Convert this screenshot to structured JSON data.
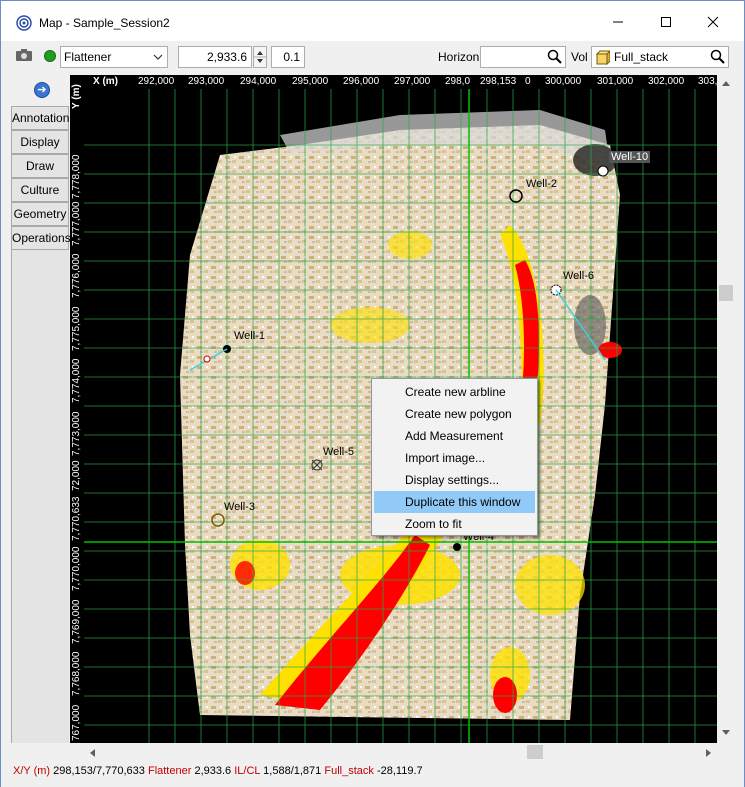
{
  "window": {
    "title": "Map - Sample_Session2",
    "minimize": "—",
    "maximize": "☐",
    "close": "✕"
  },
  "toolbar": {
    "mode_value": "Flattener",
    "value_field": "2,933.6",
    "step_field": "0.1",
    "horizon_label": "Horizon",
    "horizon_value": "",
    "vol_label": "Vol",
    "vol_value": "Full_stack",
    "status_color": "#1e9e1e"
  },
  "sidetabs": [
    "Annotation",
    "Display",
    "Draw",
    "Culture",
    "Geometry",
    "Operations"
  ],
  "map": {
    "x_axis_label": "X (m)",
    "y_axis_label": "Y (m)",
    "x_ticks": [
      "292,000",
      "293,000",
      "294,000",
      "295,000",
      "296,000",
      "297,000",
      "298,0",
      "298,153",
      "0",
      "300,000",
      "301,000",
      "302,000",
      "303,"
    ],
    "y_ticks": [
      "7,778,000",
      "7,777,000",
      "7,776,000",
      "7,775,000",
      "7,774,000",
      "7,773,000",
      "72,000",
      "7,770,633",
      "7,770,000",
      "7,769,000",
      "7,768,000",
      "767,000"
    ],
    "wells": [
      "Well-10",
      "Well-2",
      "Well-6",
      "Well-1",
      "Well-5",
      "Well-3",
      "Well-4"
    ],
    "colors": {
      "background": "#000000",
      "grid": "#2aa84a",
      "crosshair": "#00c000",
      "amplitude_high": "#ff0000",
      "amplitude_mid": "#ffff00",
      "amplitude_low": "#c8a060"
    }
  },
  "context_menu": {
    "items": [
      "Create new arbline",
      "Create new polygon",
      "Add Measurement",
      "Import image...",
      "Display settings...",
      "Duplicate this window",
      "Zoom to fit"
    ],
    "highlighted": "Duplicate this window"
  },
  "statusbar": {
    "xy_label": "X/Y (m)",
    "xy_value": "298,153/7,770,633",
    "flattener_label": "Flattener",
    "flattener_value": "2,933.6",
    "ilcl_label": "IL/CL",
    "ilcl_value": "1,588/1,871",
    "vol_label": "Full_stack",
    "vol_value": "-28,119.7"
  }
}
